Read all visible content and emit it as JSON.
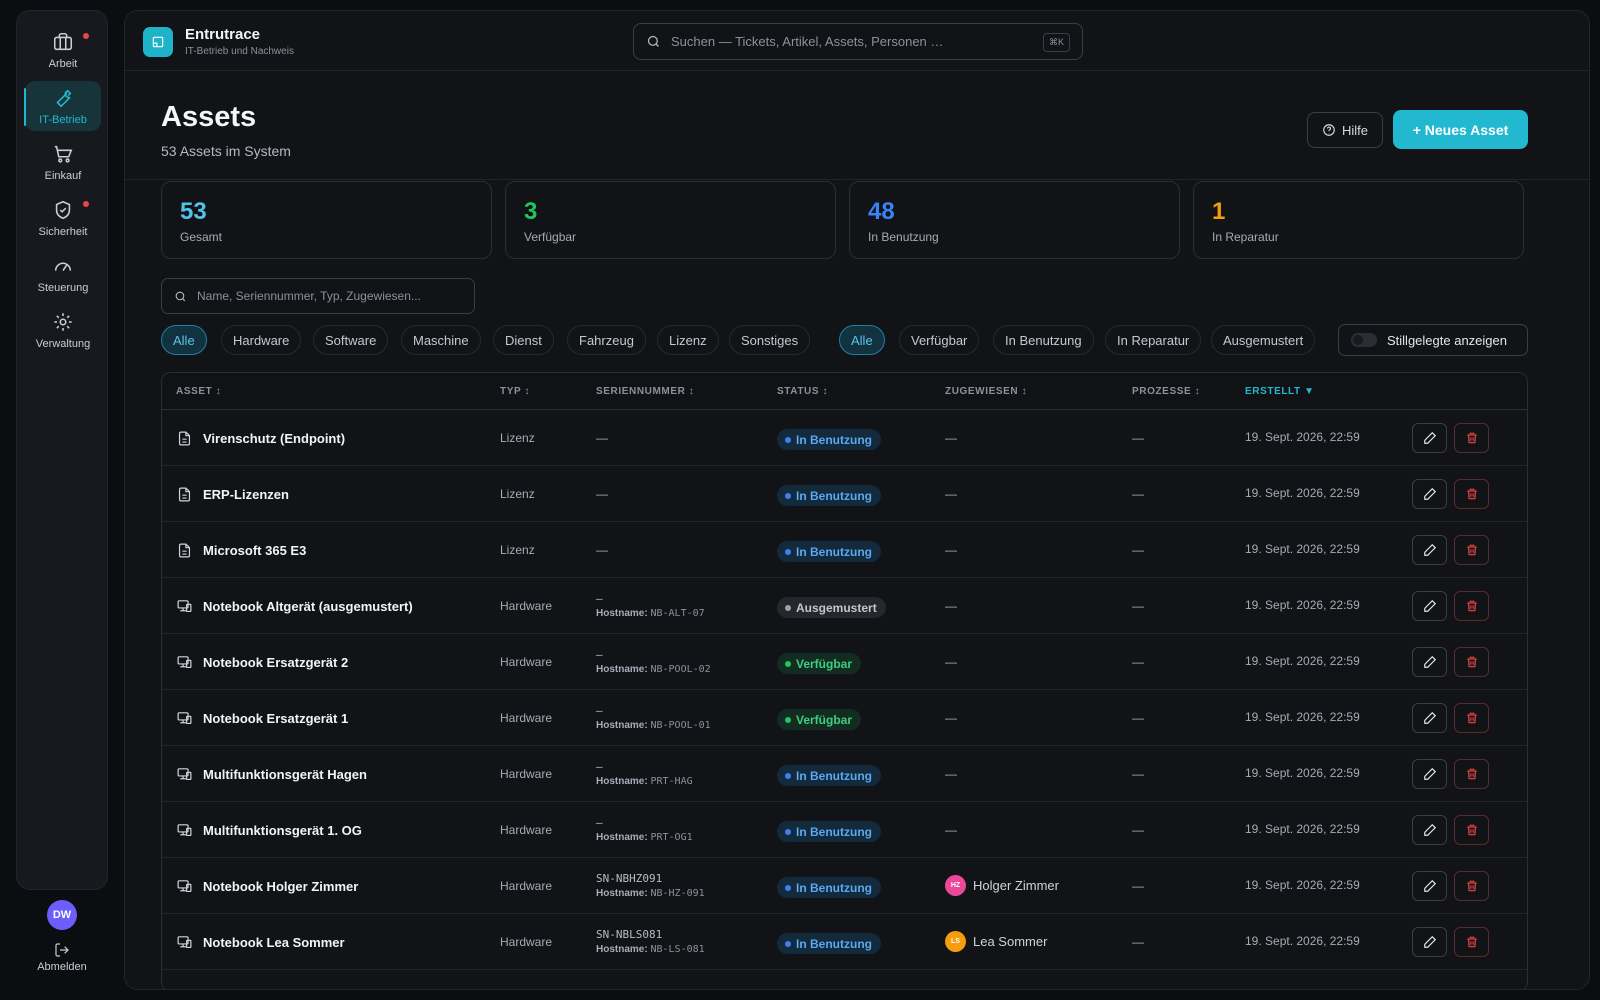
{
  "sidebar": {
    "items": [
      {
        "label": "Arbeit",
        "icon": "briefcase-icon",
        "notification": true
      },
      {
        "label": "IT-Betrieb",
        "icon": "wrench-icon",
        "active": true
      },
      {
        "label": "Einkauf",
        "icon": "cart-icon"
      },
      {
        "label": "Sicherheit",
        "icon": "shield-icon",
        "notification": true
      },
      {
        "label": "Steuerung",
        "icon": "gauge-icon"
      },
      {
        "label": "Verwaltung",
        "icon": "gear-icon"
      }
    ],
    "user_initials": "DW",
    "logout_label": "Abmelden"
  },
  "app": {
    "title": "Entrutrace",
    "subtitle": "IT-Betrieb und Nachweis"
  },
  "search": {
    "placeholder": "Suchen — Tickets, Artikel, Assets, Personen …",
    "shortcut": "⌘K"
  },
  "page": {
    "title": "Assets",
    "subtitle": "53 Assets im System",
    "help_label": "Hilfe",
    "new_label": "+ Neues Asset"
  },
  "stats": [
    {
      "value": "53",
      "label": "Gesamt",
      "color": "#4fc3e8"
    },
    {
      "value": "3",
      "label": "Verfügbar",
      "color": "#22c55e"
    },
    {
      "value": "48",
      "label": "In Benutzung",
      "color": "#3b82f6"
    },
    {
      "value": "1",
      "label": "In Reparatur",
      "color": "#f59e0b"
    }
  ],
  "filter_search": {
    "placeholder": "Name, Seriennummer, Typ, Zugewiesen..."
  },
  "type_filters": [
    "Alle",
    "Hardware",
    "Software",
    "Maschine",
    "Dienst",
    "Fahrzeug",
    "Lizenz",
    "Sonstiges"
  ],
  "status_filters": [
    "Alle",
    "Verfügbar",
    "In Benutzung",
    "In Reparatur",
    "Ausgemustert"
  ],
  "toggle_label": "Stillgelegte anzeigen",
  "table": {
    "columns": [
      "ASSET ↕",
      "TYP ↕",
      "SERIENNUMMER ↕",
      "STATUS ↕",
      "ZUGEWIESEN ↕",
      "PROZESSE ↕",
      "ERSTELLT ▼"
    ],
    "hostname_label": "Hostname:",
    "rows": [
      {
        "name": "Virenschutz (Endpoint)",
        "type": "Lizenz",
        "kind": "license",
        "serial": "—",
        "hostname": "",
        "status": "In Benutzung",
        "status_kind": "use",
        "assigned": "—",
        "assigned_initials": "",
        "processes": "—",
        "created": "19. Sept. 2026, 22:59"
      },
      {
        "name": "ERP-Lizenzen",
        "type": "Lizenz",
        "kind": "license",
        "serial": "—",
        "hostname": "",
        "status": "In Benutzung",
        "status_kind": "use",
        "assigned": "—",
        "assigned_initials": "",
        "processes": "—",
        "created": "19. Sept. 2026, 22:59"
      },
      {
        "name": "Microsoft 365 E3",
        "type": "Lizenz",
        "kind": "license",
        "serial": "—",
        "hostname": "",
        "status": "In Benutzung",
        "status_kind": "use",
        "assigned": "—",
        "assigned_initials": "",
        "processes": "—",
        "created": "19. Sept. 2026, 22:59"
      },
      {
        "name": "Notebook Altgerät (ausgemustert)",
        "type": "Hardware",
        "kind": "hardware",
        "serial": "—",
        "hostname": "NB-ALT-07",
        "status": "Ausgemustert",
        "status_kind": "ret",
        "assigned": "—",
        "assigned_initials": "",
        "processes": "—",
        "created": "19. Sept. 2026, 22:59"
      },
      {
        "name": "Notebook Ersatzgerät 2",
        "type": "Hardware",
        "kind": "hardware",
        "serial": "—",
        "hostname": "NB-POOL-02",
        "status": "Verfügbar",
        "status_kind": "av",
        "assigned": "—",
        "assigned_initials": "",
        "processes": "—",
        "created": "19. Sept. 2026, 22:59"
      },
      {
        "name": "Notebook Ersatzgerät 1",
        "type": "Hardware",
        "kind": "hardware",
        "serial": "—",
        "hostname": "NB-POOL-01",
        "status": "Verfügbar",
        "status_kind": "av",
        "assigned": "—",
        "assigned_initials": "",
        "processes": "—",
        "created": "19. Sept. 2026, 22:59"
      },
      {
        "name": "Multifunktionsgerät Hagen",
        "type": "Hardware",
        "kind": "hardware",
        "serial": "—",
        "hostname": "PRT-HAG",
        "status": "In Benutzung",
        "status_kind": "use",
        "assigned": "—",
        "assigned_initials": "",
        "processes": "—",
        "created": "19. Sept. 2026, 22:59"
      },
      {
        "name": "Multifunktionsgerät 1. OG",
        "type": "Hardware",
        "kind": "hardware",
        "serial": "—",
        "hostname": "PRT-OG1",
        "status": "In Benutzung",
        "status_kind": "use",
        "assigned": "—",
        "assigned_initials": "",
        "processes": "—",
        "created": "19. Sept. 2026, 22:59"
      },
      {
        "name": "Notebook Holger Zimmer",
        "type": "Hardware",
        "kind": "hardware",
        "serial": "SN-NBHZ091",
        "hostname": "NB-HZ-091",
        "status": "In Benutzung",
        "status_kind": "use",
        "assigned": "Holger Zimmer",
        "assigned_initials": "HZ",
        "assigned_color": "#ec4899",
        "processes": "—",
        "created": "19. Sept. 2026, 22:59"
      },
      {
        "name": "Notebook Lea Sommer",
        "type": "Hardware",
        "kind": "hardware",
        "serial": "SN-NBLS081",
        "hostname": "NB-LS-081",
        "status": "In Benutzung",
        "status_kind": "use",
        "assigned": "Lea Sommer",
        "assigned_initials": "LS",
        "assigned_color": "#f59e0b",
        "processes": "—",
        "created": "19. Sept. 2026, 22:59"
      }
    ]
  }
}
